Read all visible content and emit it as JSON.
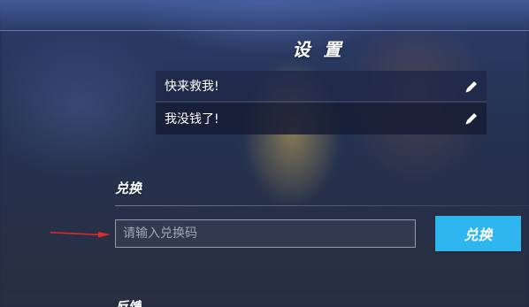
{
  "settings": {
    "title": "设 置"
  },
  "quick_chat": {
    "items": [
      {
        "label": "快来救我!",
        "icon": "pencil-icon"
      },
      {
        "label": "我没钱了!",
        "icon": "pencil-icon"
      }
    ]
  },
  "redeem": {
    "section_label": "兑换",
    "placeholder": "请输入兑换码",
    "value": "",
    "button_label": "兑换",
    "button_color": "#2fb6ef",
    "annotation_arrow_color": "#e02a2a"
  },
  "next_section": {
    "label": "反馈"
  }
}
